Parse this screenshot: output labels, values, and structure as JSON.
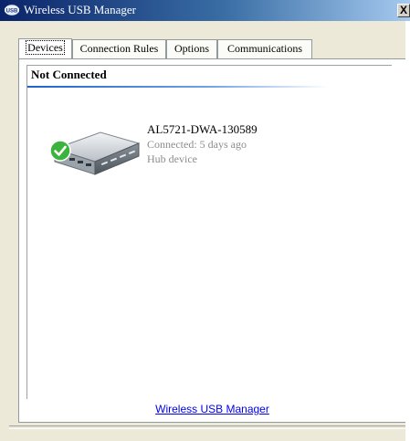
{
  "window": {
    "title": "Wireless USB Manager",
    "title_icon": "usb-app-icon",
    "close_label": "X"
  },
  "tabs": [
    {
      "label": "Devices",
      "active": true
    },
    {
      "label": "Connection Rules",
      "active": false
    },
    {
      "label": "Options",
      "active": false
    },
    {
      "label": "Communications",
      "active": false
    }
  ],
  "panel": {
    "status_title": "Not Connected",
    "device": {
      "icon": "usb-hub-icon",
      "status_icon": "check-icon",
      "name": "AL5721-DWA-130589",
      "connected": "Connected: 5 days ago",
      "type": "Hub device"
    },
    "footer_link": "Wireless USB Manager"
  },
  "colors": {
    "title_start": "#0a246a",
    "title_end": "#a6caf0",
    "rule": "#1d62c8",
    "check": "#3cb33c",
    "link": "#0000ee"
  }
}
